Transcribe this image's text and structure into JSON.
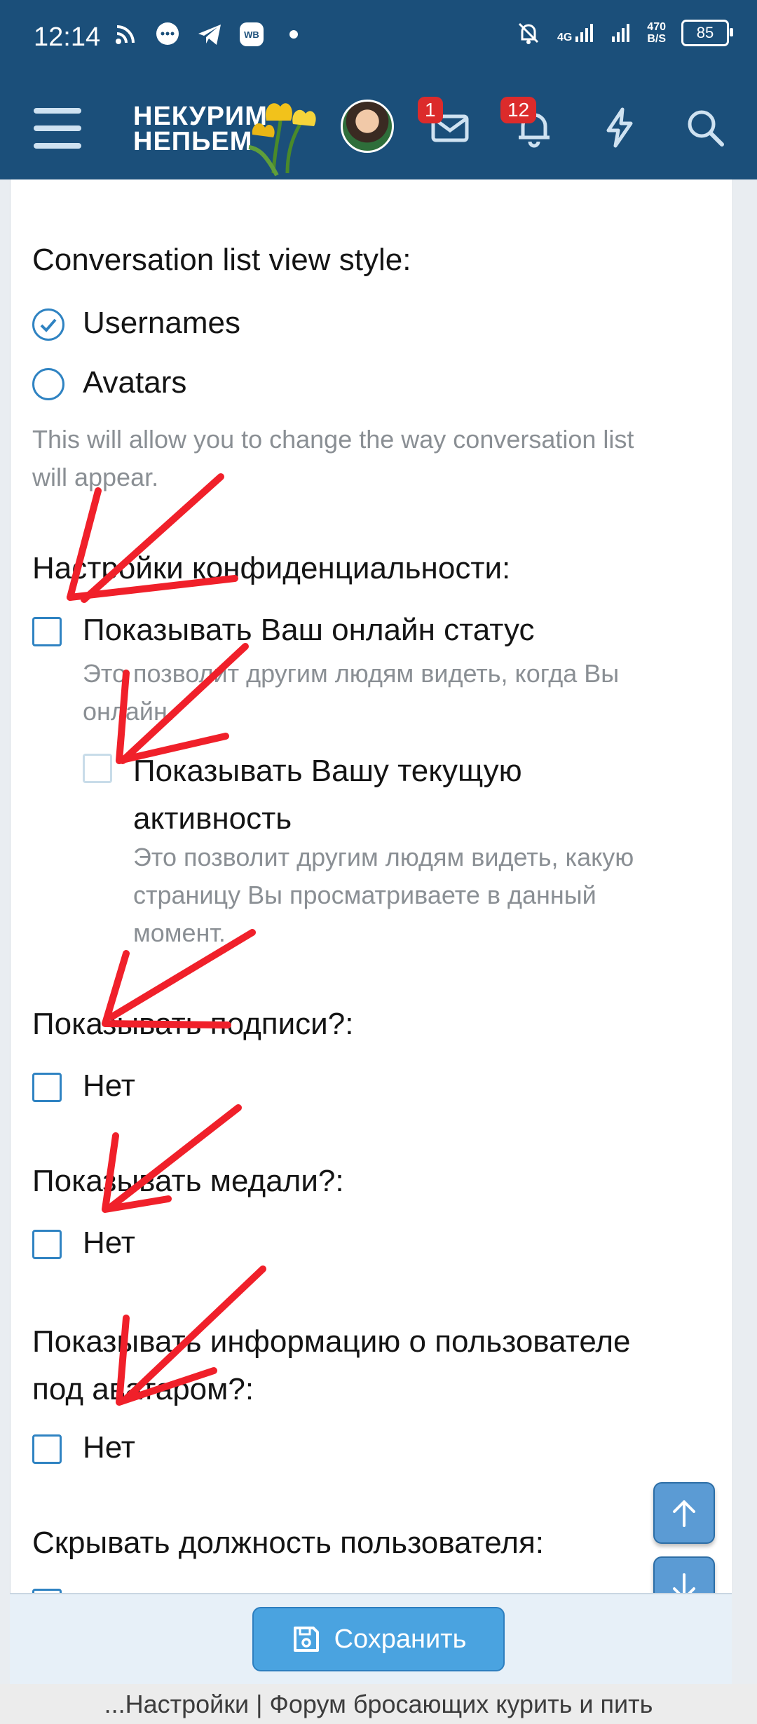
{
  "status_bar": {
    "time": "12:14",
    "net_speed_value": "470",
    "net_speed_unit": "B/S",
    "network": "4G",
    "battery": "85",
    "left_icons": [
      "cast-icon",
      "chat-icon",
      "telegram-icon",
      "wb-icon",
      "dot-icon"
    ],
    "right_icons": [
      "bell-off-icon",
      "signal-icon",
      "signal-icon",
      "battery-icon"
    ]
  },
  "navbar": {
    "logo_line1": "НЕКУРИМ",
    "logo_line2": "НЕПЬЕМ",
    "messages_badge": "1",
    "alerts_badge": "12",
    "icons": [
      "menu-icon",
      "envelope-icon",
      "bell-icon",
      "lightning-icon",
      "search-icon"
    ]
  },
  "settings": {
    "conversation_label": "Conversation list view style:",
    "option_usernames": "Usernames",
    "option_avatars": "Avatars",
    "conversation_hint_line1": "This will allow you to change the way conversation list",
    "conversation_hint_line2": "will appear.",
    "privacy_label": "Настройки конфиденциальности:",
    "online_status_label": "Показывать Ваш онлайн статус",
    "online_status_hint_line1": "Это позволит другим людям видеть, когда Вы",
    "online_status_hint_line2": "онлайн.",
    "activity_label_line1": "Показывать Вашу текущую",
    "activity_label_line2": "активность",
    "activity_hint_line1": "Это позволит другим людям видеть, какую",
    "activity_hint_line2": "страницу Вы просматриваете в данный",
    "activity_hint_line3": "момент.",
    "signatures_label": "Показывать подписи?:",
    "signatures_option": "Нет",
    "medals_label": "Показывать медали?:",
    "medals_option": "Нет",
    "userinfo_label_line1": "Показывать информацию о пользователе",
    "userinfo_label_line2": "под аватаром?:",
    "userinfo_option": "Нет",
    "hide_title_label": "Скрывать должность пользователя:"
  },
  "actions": {
    "save_label": "Сохранить"
  },
  "footer": {
    "page_title": "...Настройки | Форум бросающих курить и пить"
  },
  "colors": {
    "header_bg": "#1b4f7a",
    "accent": "#2f83c2",
    "button": "#4aa3e0",
    "annotation": "#f0202a"
  }
}
